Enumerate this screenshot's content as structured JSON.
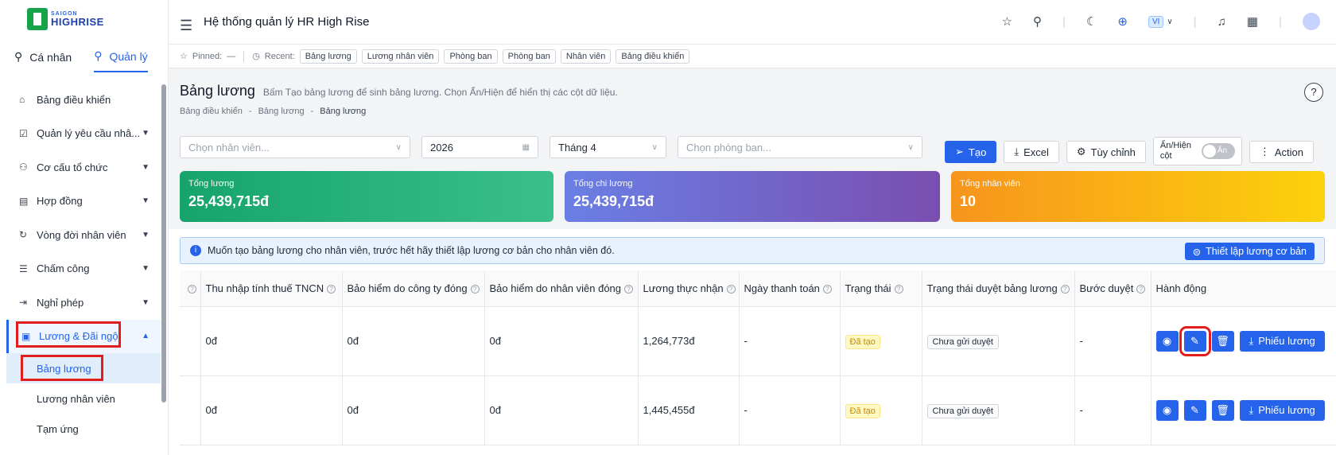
{
  "app": {
    "title": "Hệ thống quản lý HR High Rise",
    "logo_line1": "SAIGON",
    "logo_line2": "HIGHRISE",
    "language": "VI"
  },
  "modes": [
    {
      "label": "Cá nhân"
    },
    {
      "label": "Quản lý"
    }
  ],
  "sidebar": {
    "items": [
      {
        "label": "Bảng điều khiển",
        "icon": "home-icon"
      },
      {
        "label": "Quản lý yêu cầu nhâ...",
        "icon": "checkbox-icon"
      },
      {
        "label": "Cơ cấu tổ chức",
        "icon": "org-chart-icon"
      },
      {
        "label": "Hợp đồng",
        "icon": "contract-icon"
      },
      {
        "label": "Vòng đời nhân viên",
        "icon": "refresh-icon"
      },
      {
        "label": "Chấm công",
        "icon": "list-icon"
      },
      {
        "label": "Nghỉ phép",
        "icon": "logout-icon"
      },
      {
        "label": "Lương & Đãi ngộ",
        "icon": "wallet-icon"
      }
    ],
    "sub_items": [
      {
        "label": "Bảng lương"
      },
      {
        "label": "Lương nhân viên"
      },
      {
        "label": "Tạm ứng"
      }
    ]
  },
  "pinbar": {
    "pinned_label": "Pinned:",
    "pinned_value": "—",
    "recent_label": "Recent:",
    "recent": [
      "Bảng lương",
      "Lương nhân viên",
      "Phòng ban",
      "Phòng ban",
      "Nhân viên",
      "Bảng điều khiển"
    ]
  },
  "page": {
    "title": "Bảng lương",
    "description": "Bấm Tạo bảng lương để sinh bảng lương. Chọn Ẩn/Hiện để hiển thị các cột dữ liệu.",
    "breadcrumb": [
      "Bảng điều khiển",
      "Bảng lương",
      "Bảng lương"
    ],
    "help": "?"
  },
  "filters": {
    "employee_placeholder": "Chọn nhân viên...",
    "year": "2026",
    "month": "Tháng 4",
    "department_placeholder": "Chọn phòng ban..."
  },
  "buttons": {
    "create": "Tạo",
    "excel": "Excel",
    "customize": "Tùy chỉnh",
    "toggle_label": "Ẩn/Hiện cột",
    "toggle_state": "Ẩn",
    "action": "Action"
  },
  "cards": [
    {
      "label": "Tổng lương",
      "value": "25,439,715đ"
    },
    {
      "label": "Tổng chi lương",
      "value": "25,439,715đ"
    },
    {
      "label": "Tổng nhân viên",
      "value": "10"
    }
  ],
  "alert": {
    "text": "Muốn tạo bảng lương cho nhân viên, trước hết hãy thiết lập lương cơ bản cho nhân viên đó.",
    "button": "Thiết lập lương cơ bản"
  },
  "table": {
    "headers": [
      "Thu nhập tính thuế TNCN",
      "Bảo hiểm do công ty đóng",
      "Bảo hiểm do nhân viên đóng",
      "Lương thực nhận",
      "Ngày thanh toán",
      "Trạng thái",
      "Trạng thái duyệt bảng lương",
      "Bước duyệt",
      "Hành động"
    ],
    "rows": [
      {
        "taxable": "0đ",
        "company_ins": "0đ",
        "employee_ins": "0đ",
        "net": "1,264,773đ",
        "pay_date": "-",
        "status": "Đã tạo",
        "approval": "Chưa gửi duyệt",
        "step": "-"
      },
      {
        "taxable": "0đ",
        "company_ins": "0đ",
        "employee_ins": "0đ",
        "net": "1,445,455đ",
        "pay_date": "-",
        "status": "Đã tạo",
        "approval": "Chưa gửi duyệt",
        "step": "-"
      }
    ],
    "payslip_label": "Phiếu lương"
  }
}
